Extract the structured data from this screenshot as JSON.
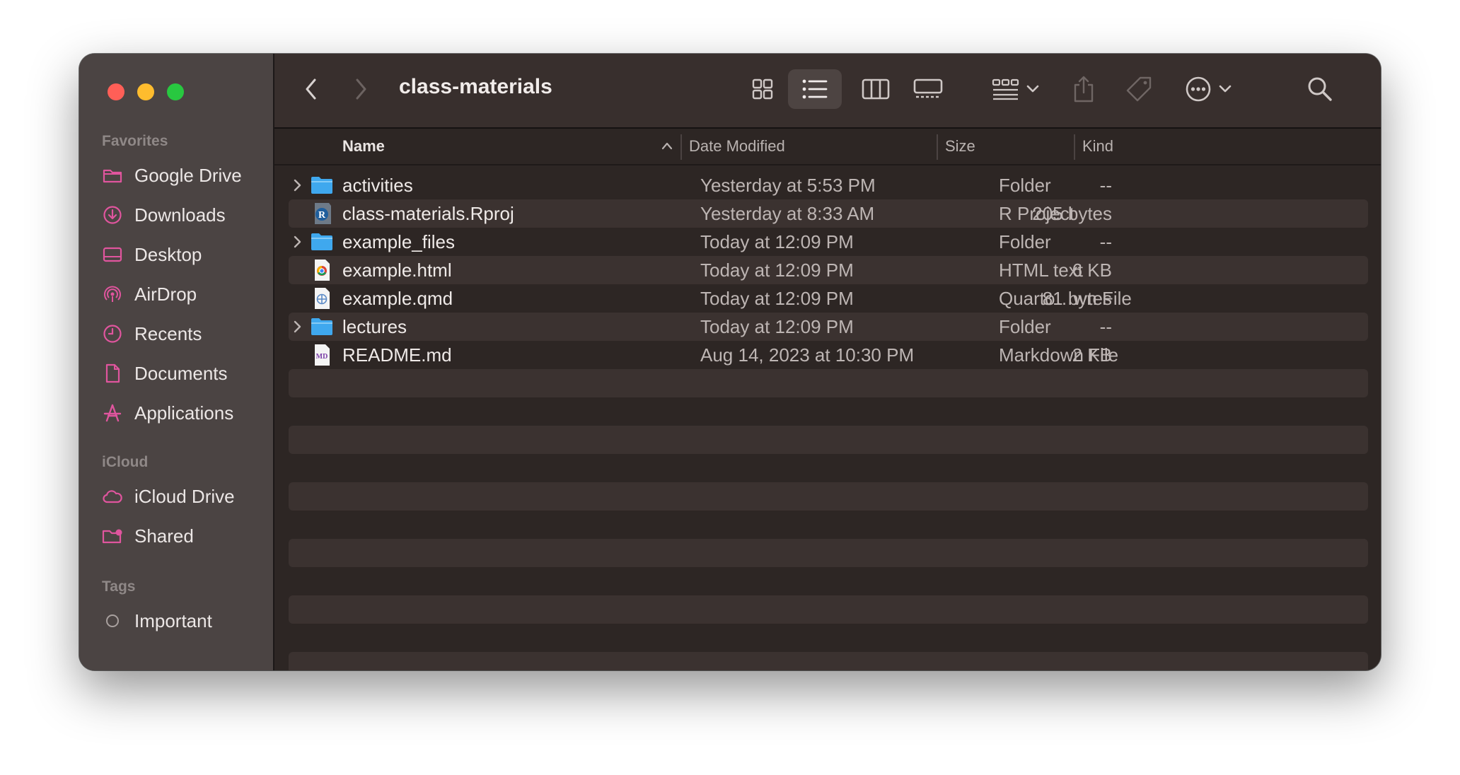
{
  "window": {
    "title": "class-materials"
  },
  "sidebar": {
    "favorites_heading": "Favorites",
    "favorites": [
      {
        "label": "Google Drive",
        "icon": "folder-icon"
      },
      {
        "label": "Downloads",
        "icon": "download-icon"
      },
      {
        "label": "Desktop",
        "icon": "desktop-icon"
      },
      {
        "label": "AirDrop",
        "icon": "airdrop-icon"
      },
      {
        "label": "Recents",
        "icon": "clock-icon"
      },
      {
        "label": "Documents",
        "icon": "document-icon"
      },
      {
        "label": "Applications",
        "icon": "applications-icon"
      }
    ],
    "icloud_heading": "iCloud",
    "icloud": [
      {
        "label": "iCloud Drive",
        "icon": "cloud-icon"
      },
      {
        "label": "Shared",
        "icon": "shared-folder-icon"
      }
    ],
    "tags_heading": "Tags",
    "tags": [
      {
        "label": "Important",
        "icon": "tag-circle-icon"
      }
    ]
  },
  "columns": {
    "name": "Name",
    "date": "Date Modified",
    "size": "Size",
    "kind": "Kind"
  },
  "files": [
    {
      "name": "activities",
      "date": "Yesterday at 5:53 PM",
      "size": "--",
      "kind": "Folder",
      "type": "folder",
      "expandable": true
    },
    {
      "name": "class-materials.Rproj",
      "date": "Yesterday at 8:33 AM",
      "size": "205 bytes",
      "kind": "R Project",
      "type": "rproj",
      "expandable": false
    },
    {
      "name": "example_files",
      "date": "Today at 12:09 PM",
      "size": "--",
      "kind": "Folder",
      "type": "folder",
      "expandable": true
    },
    {
      "name": "example.html",
      "date": "Today at 12:09 PM",
      "size": "6 KB",
      "kind": "HTML text",
      "type": "html",
      "expandable": false
    },
    {
      "name": "example.qmd",
      "date": "Today at 12:09 PM",
      "size": "81 bytes",
      "kind": "Quarto…wn File",
      "type": "qmd",
      "expandable": false
    },
    {
      "name": "lectures",
      "date": "Today at 12:09 PM",
      "size": "--",
      "kind": "Folder",
      "type": "folder",
      "expandable": true
    },
    {
      "name": "README.md",
      "date": "Aug 14, 2023 at 10:30 PM",
      "size": "2 KB",
      "kind": "Markdown File",
      "type": "md",
      "expandable": false
    }
  ],
  "colors": {
    "accent_pink": "#e0559e",
    "folder_blue": "#3fa8ee",
    "traffic_red": "#ff5f57",
    "traffic_yellow": "#febc2e",
    "traffic_green": "#28c840"
  }
}
